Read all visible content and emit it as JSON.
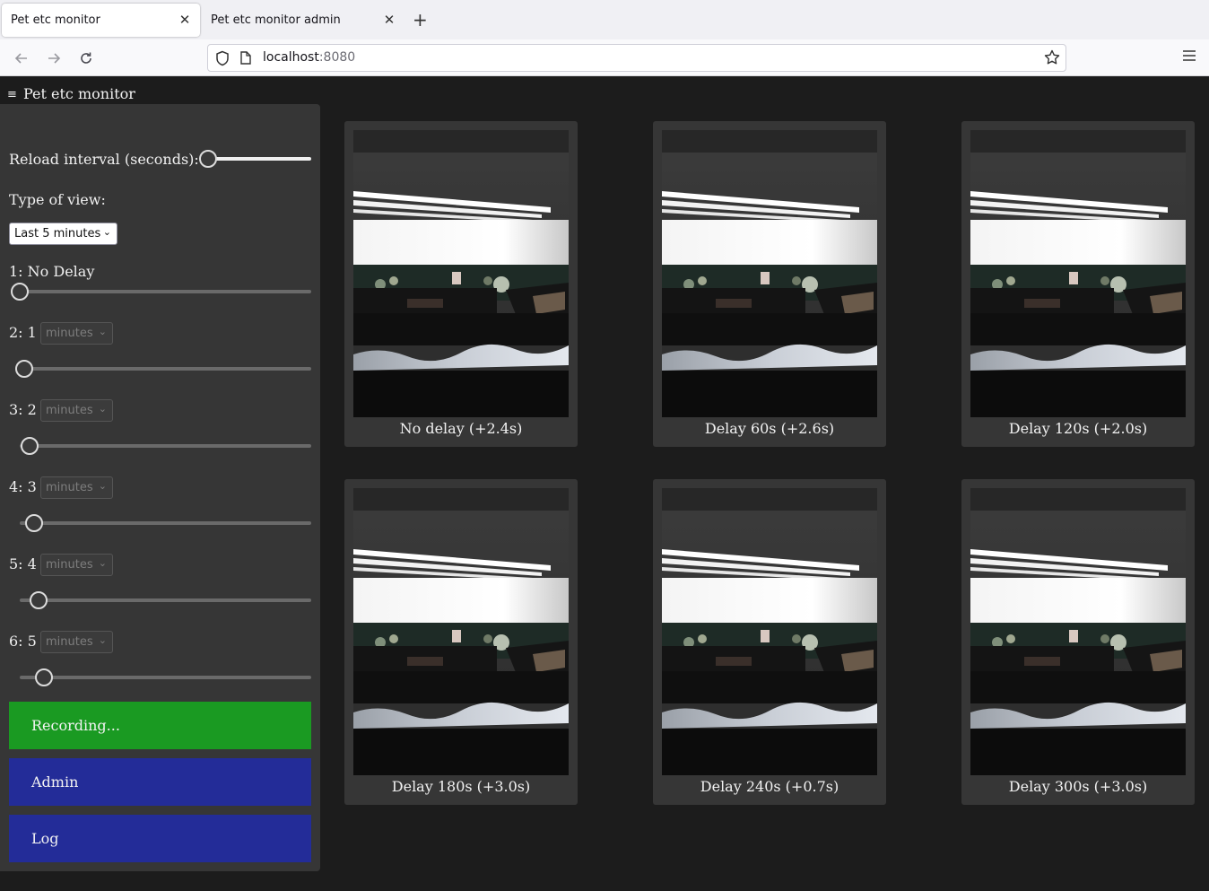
{
  "browser": {
    "tabs": [
      {
        "title": "Pet etc monitor",
        "active": true
      },
      {
        "title": "Pet etc monitor admin",
        "active": false
      }
    ],
    "url_host": "localhost",
    "url_port": ":8080"
  },
  "app": {
    "menu_icon": "≡",
    "title": "Pet etc monitor"
  },
  "sidebar": {
    "reload_label": "Reload interval (seconds): 1",
    "reload_value": 1,
    "view_type_label": "Type of view:",
    "view_type_selected": "Last 5 minutes",
    "delays": [
      {
        "label": "1: No Delay",
        "unit": null,
        "slider_fraction": 0.0
      },
      {
        "label": "2: 1",
        "unit": "minutes",
        "slider_fraction": 0.016
      },
      {
        "label": "3: 2",
        "unit": "minutes",
        "slider_fraction": 0.033
      },
      {
        "label": "4: 3",
        "unit": "minutes",
        "slider_fraction": 0.049
      },
      {
        "label": "5: 4",
        "unit": "minutes",
        "slider_fraction": 0.066
      },
      {
        "label": "6: 5",
        "unit": "minutes",
        "slider_fraction": 0.082
      }
    ],
    "recording_label": "Recording...",
    "admin_label": "Admin",
    "log_label": "Log",
    "colors": {
      "recording": "#1a9a22",
      "nav_button": "#232c98"
    }
  },
  "cameras": [
    {
      "caption": "No delay (+2.4s)"
    },
    {
      "caption": "Delay 60s (+2.6s)"
    },
    {
      "caption": "Delay 120s (+2.0s)"
    },
    {
      "caption": "Delay 180s (+3.0s)"
    },
    {
      "caption": "Delay 240s (+0.7s)"
    },
    {
      "caption": "Delay 300s (+3.0s)"
    }
  ]
}
